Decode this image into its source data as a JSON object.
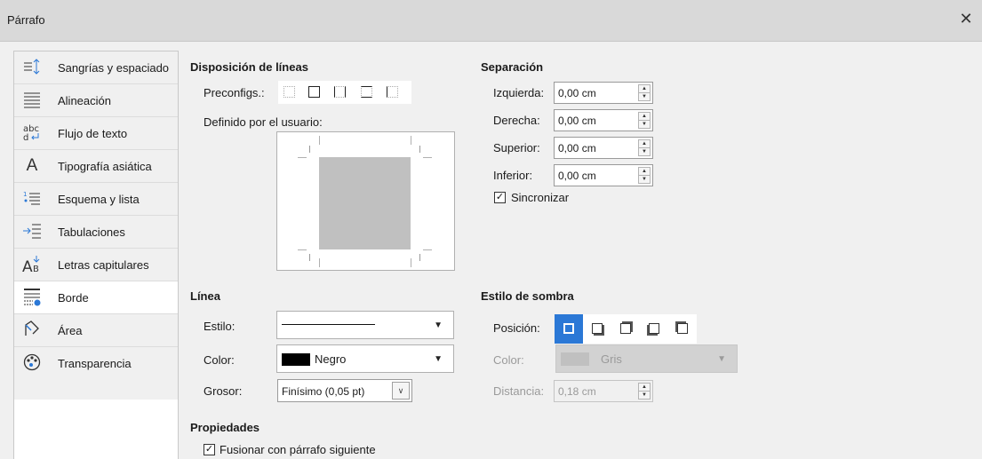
{
  "window": {
    "title": "Párrafo",
    "close_icon": "close-icon"
  },
  "sidebar": {
    "items": [
      {
        "label": "Sangrías y espaciado",
        "icon": "indent-spacing-icon",
        "glyph": "≡↕"
      },
      {
        "label": "Alineación",
        "icon": "align-justify-icon",
        "glyph": "☰"
      },
      {
        "label": "Flujo de texto",
        "icon": "text-flow-icon",
        "glyph": "abc"
      },
      {
        "label": "Tipografía asiática",
        "icon": "asian-typography-icon",
        "glyph": "A"
      },
      {
        "label": "Esquema y lista",
        "icon": "outline-list-icon",
        "glyph": "⁝≡"
      },
      {
        "label": "Tabulaciones",
        "icon": "tabs-icon",
        "glyph": "→≡"
      },
      {
        "label": "Letras capitulares",
        "icon": "drop-caps-icon",
        "glyph": "AB"
      },
      {
        "label": "Borde",
        "icon": "borders-icon",
        "glyph": "▤"
      },
      {
        "label": "Área",
        "icon": "area-fill-icon",
        "glyph": "◸"
      },
      {
        "label": "Transparencia",
        "icon": "transparency-icon",
        "glyph": "◎"
      }
    ],
    "active_index": 7
  },
  "line_arrangement": {
    "title": "Disposición de líneas",
    "presets_label": "Preconfigs.:",
    "user_defined_label": "Definido por el usuario:"
  },
  "padding": {
    "title": "Separación",
    "left_label": "Izquierda:",
    "left_value": "0,00 cm",
    "right_label": "Derecha:",
    "right_value": "0,00 cm",
    "top_label": "Superior:",
    "top_value": "0,00 cm",
    "bottom_label": "Inferior:",
    "bottom_value": "0,00 cm",
    "sync_label": "Sincronizar",
    "sync_checked": true
  },
  "line": {
    "title": "Línea",
    "style_label": "Estilo:",
    "color_label": "Color:",
    "color_value": "Negro",
    "color_swatch": "#000000",
    "width_label": "Grosor:",
    "width_value": "Finísimo (0,05 pt)"
  },
  "shadow": {
    "title": "Estilo de sombra",
    "position_label": "Posición:",
    "color_label": "Color:",
    "color_value": "Gris",
    "color_swatch": "#c0c0c0",
    "distance_label": "Distancia:",
    "distance_value": "0,18 cm"
  },
  "properties": {
    "title": "Propiedades",
    "merge_label": "Fusionar con párrafo siguiente",
    "merge_checked": true
  },
  "colors": {
    "accent": "#2b78d6",
    "titlebar": "#d9d9d9",
    "panel": "#f0f0f0"
  }
}
